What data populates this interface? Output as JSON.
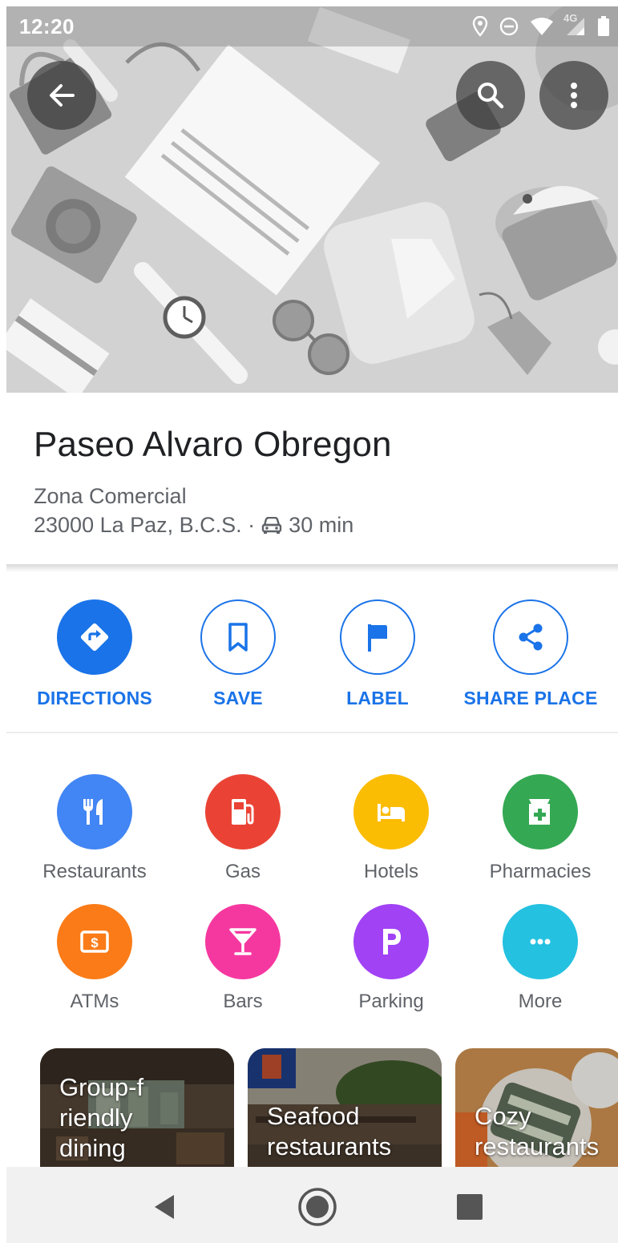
{
  "status_bar": {
    "time": "12:20",
    "network": "4G",
    "icons": [
      "location-icon",
      "do-not-disturb-icon",
      "wifi-icon",
      "signal-icon",
      "battery-icon"
    ]
  },
  "header_buttons": {
    "back": "back-arrow-icon",
    "search": "search-icon",
    "menu": "more-vert-icon"
  },
  "place": {
    "name": "Paseo Alvaro Obregon",
    "category": "Zona Comercial",
    "address": "23000 La Paz, B.C.S. ·",
    "drive_time": "30 min"
  },
  "actions": [
    {
      "label": "DIRECTIONS",
      "icon": "directions-icon"
    },
    {
      "label": "SAVE",
      "icon": "bookmark-icon"
    },
    {
      "label": "LABEL",
      "icon": "flag-icon"
    },
    {
      "label": "SHARE PLACE",
      "icon": "share-icon"
    }
  ],
  "categories": [
    {
      "label": "Restaurants",
      "icon": "restaurant-icon",
      "color": "#4285f4"
    },
    {
      "label": "Gas",
      "icon": "gas-station-icon",
      "color": "#ea4335"
    },
    {
      "label": "Hotels",
      "icon": "hotel-icon",
      "color": "#fbbc04"
    },
    {
      "label": "Pharmacies",
      "icon": "pharmacy-icon",
      "color": "#34a853"
    },
    {
      "label": "ATMs",
      "icon": "atm-icon",
      "color": "#fa7b17"
    },
    {
      "label": "Bars",
      "icon": "cocktail-icon",
      "color": "#f538a0"
    },
    {
      "label": "Parking",
      "icon": "parking-icon",
      "color": "#a142f4"
    },
    {
      "label": "More",
      "icon": "more-horiz-icon",
      "color": "#24c1e0"
    }
  ],
  "cards": [
    {
      "lines": [
        "Group-f",
        "riendly",
        "dining"
      ]
    },
    {
      "lines": [
        "Seafood",
        "restaurants"
      ]
    },
    {
      "lines": [
        "Cozy",
        "restaurants"
      ]
    }
  ],
  "colors": {
    "accent": "#1a73e8",
    "text_primary": "#202124",
    "text_secondary": "#5f6368"
  }
}
